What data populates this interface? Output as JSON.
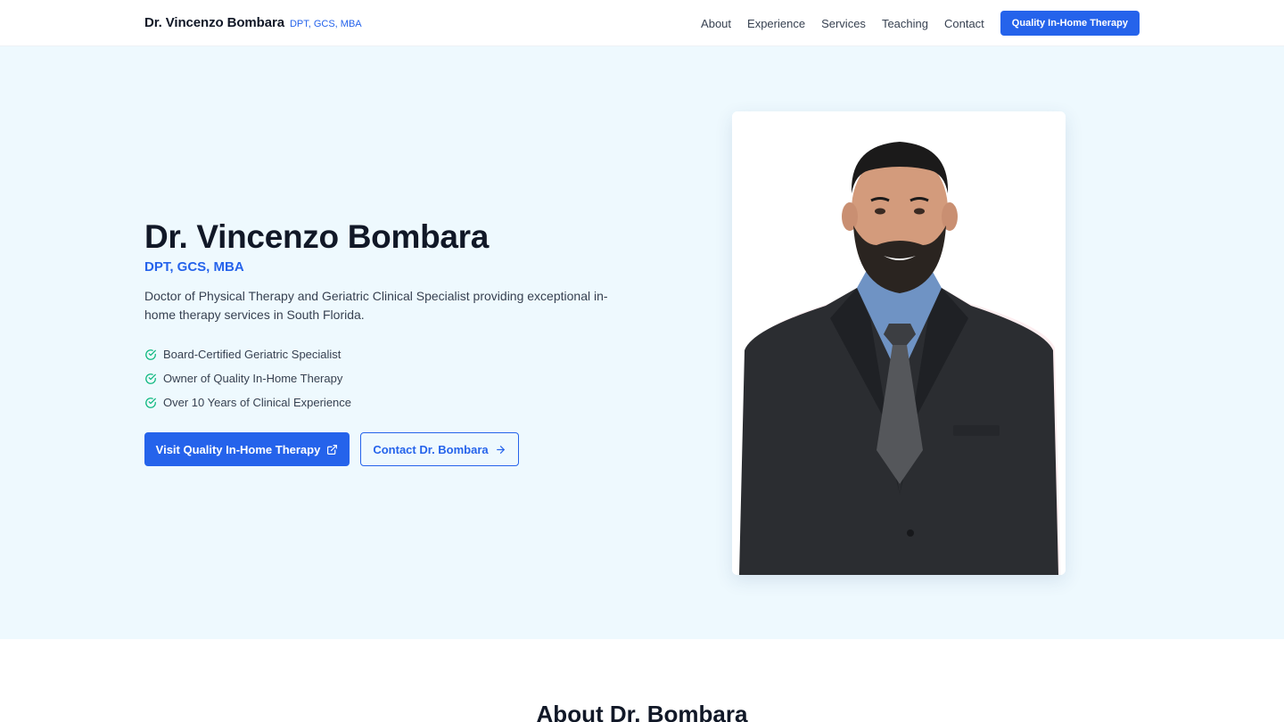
{
  "header": {
    "brand_name": "Dr. Vincenzo Bombara",
    "brand_creds": "DPT, GCS, MBA",
    "nav": [
      {
        "label": "About"
      },
      {
        "label": "Experience"
      },
      {
        "label": "Services"
      },
      {
        "label": "Teaching"
      },
      {
        "label": "Contact"
      }
    ],
    "cta_label": "Quality In-Home Therapy"
  },
  "hero": {
    "title": "Dr. Vincenzo Bombara",
    "creds": "DPT, GCS, MBA",
    "description": "Doctor of Physical Therapy and Geriatric Clinical Specialist providing exceptional in-home therapy services in South Florida.",
    "highlights": [
      {
        "label": "Board-Certified Geriatric Specialist",
        "icon": "check-circle-icon"
      },
      {
        "label": "Owner of Quality In-Home Therapy",
        "icon": "check-circle-icon"
      },
      {
        "label": "Over 10 Years of Clinical Experience",
        "icon": "check-circle-icon"
      }
    ],
    "primary_button": {
      "label": "Visit Quality In-Home Therapy",
      "icon": "external-link-icon"
    },
    "secondary_button": {
      "label": "Contact Dr. Bombara",
      "icon": "arrow-right-icon"
    },
    "photo": {
      "icon": "portrait-photo"
    }
  },
  "about": {
    "title": "About Dr. Bombara"
  },
  "colors": {
    "accent": "#2563eb",
    "hero_background": "#eef9fe",
    "check": "#10b981",
    "text": "#111827",
    "muted_text": "#374151"
  }
}
